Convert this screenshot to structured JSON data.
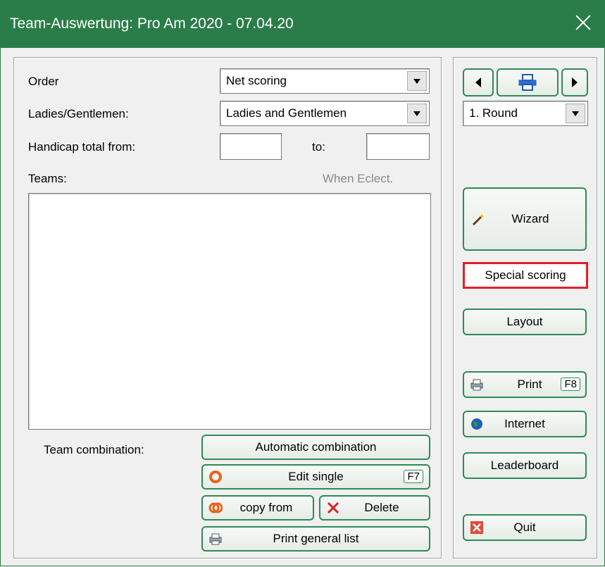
{
  "window": {
    "title": "Team-Auswertung: Pro Am 2020 - 07.04.20"
  },
  "form": {
    "order_label": "Order",
    "order_value": "Net scoring",
    "gender_label": "Ladies/Gentlemen:",
    "gender_value": "Ladies and Gentlemen",
    "handicap_label": "Handicap total from:",
    "handicap_from": "",
    "to_label": "to:",
    "handicap_to": "",
    "teams_label": "Teams:",
    "when_eclect": "When Eclect.",
    "team_combination_label": "Team combination:"
  },
  "buttons": {
    "automatic": "Automatic combination",
    "edit_single": "Edit single",
    "edit_single_key": "F7",
    "copy_from": "copy from",
    "delete": "Delete",
    "print_general": "Print general list"
  },
  "side": {
    "round_value": "1. Round",
    "wizard": "Wizard",
    "special_scoring": "Special scoring",
    "layout": "Layout",
    "print": "Print",
    "print_key": "F8",
    "internet": "Internet",
    "leaderboard": "Leaderboard",
    "quit": "Quit"
  },
  "colors": {
    "titlebar": "#2a7d48",
    "button_border": "#2e8b57",
    "highlight": "#e0202a"
  }
}
